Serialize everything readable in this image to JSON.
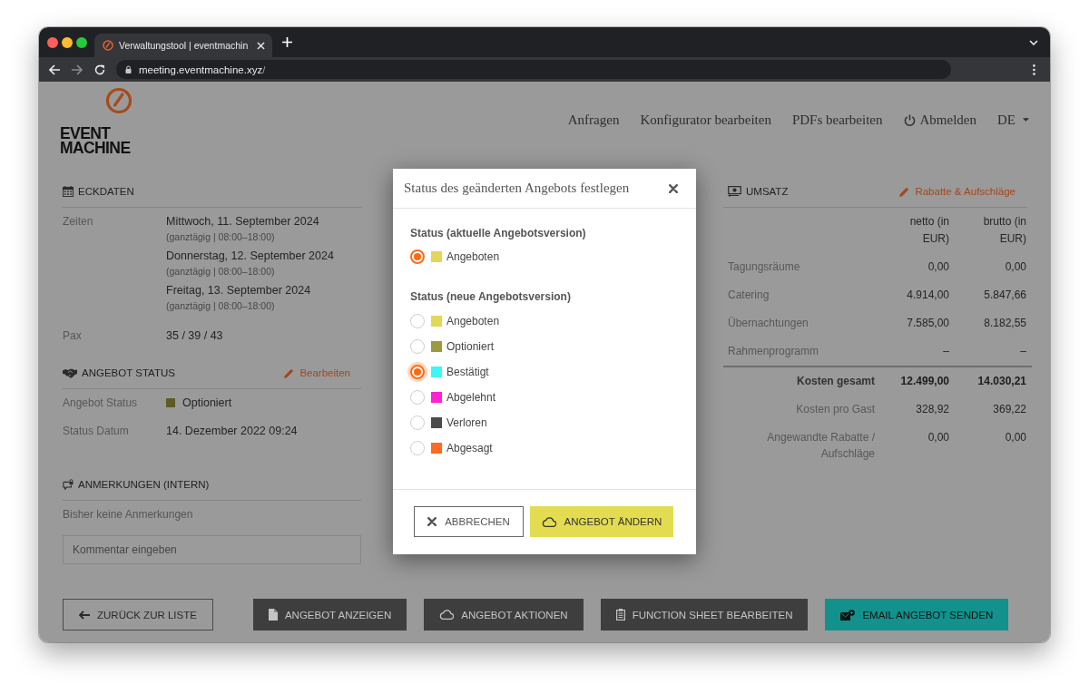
{
  "browser": {
    "tab_title": "Verwaltungstool | eventmachin",
    "url_host": "meeting.eventmachine.xyz",
    "url_path": "/"
  },
  "header": {
    "logo_text": "EVENT MACHINE",
    "nav": [
      {
        "kind": "link",
        "label": "Anfragen"
      },
      {
        "kind": "link",
        "label": "Konfigurator bearbeiten"
      },
      {
        "kind": "link",
        "label": "PDFs bearbeiten"
      },
      {
        "kind": "logout",
        "label": "Abmelden"
      },
      {
        "kind": "language",
        "label": "DE"
      }
    ]
  },
  "eckdaten": {
    "title": "ECKDATEN",
    "rows": [
      {
        "kind": "dates",
        "label": "Zeiten",
        "entries": [
          {
            "date": "Mittwoch, 11. September 2024",
            "note": "(ganztägig | 08:00–18:00)"
          },
          {
            "date": "Donnerstag, 12. September 2024",
            "note": "(ganztägig | 08:00–18:00)"
          },
          {
            "date": "Freitag, 13. September 2024",
            "note": "(ganztägig | 08:00–18:00)"
          }
        ]
      },
      {
        "kind": "text",
        "label": "Pax",
        "value": "35 / 39 / 43"
      }
    ]
  },
  "angebot_status": {
    "title": "ANGEBOT STATUS",
    "action": "Bearbeiten",
    "rows": [
      {
        "kind": "status",
        "label": "Angebot Status",
        "value": "Optioniert",
        "color": "#5c5c24"
      },
      {
        "kind": "text",
        "label": "Status Datum",
        "value": "14. Dezember 2022 09:24"
      }
    ]
  },
  "anmerkungen": {
    "title": "ANMERKUNGEN (INTERN)",
    "empty_text": "Bisher keine Anmerkungen",
    "comment_field": {
      "placeholder": "Kommentar eingeben"
    }
  },
  "umsatz": {
    "title": "UMSATZ",
    "action": "Rabatte & Aufschläge",
    "columns": [
      "netto (in EUR)",
      "brutto (in EUR)"
    ],
    "rows": [
      {
        "label": "Tagungsräume",
        "netto": "0,00",
        "brutto": "0,00"
      },
      {
        "label": "Catering",
        "netto": "4.914,00",
        "brutto": "5.847,66"
      },
      {
        "label": "Übernachtungen",
        "netto": "7.585,00",
        "brutto": "8.182,55"
      },
      {
        "label": "Rahmenprogramm",
        "netto": "–",
        "brutto": "–"
      }
    ],
    "summary": [
      {
        "kind": "total",
        "label": "Kosten gesamt",
        "netto": "12.499,00",
        "brutto": "14.030,21"
      },
      {
        "kind": "plain",
        "label": "Kosten pro Gast",
        "netto": "328,92",
        "brutto": "369,22"
      },
      {
        "kind": "plain",
        "label": "Angewandte Rabatte / Aufschläge",
        "netto": "0,00",
        "brutto": "0,00"
      }
    ]
  },
  "footer_buttons": [
    {
      "kind": "outline",
      "label": "ZURÜCK ZUR LISTE"
    },
    {
      "kind": "dark",
      "label": "ANGEBOT ANZEIGEN"
    },
    {
      "kind": "dark",
      "label": "ANGEBOT AKTIONEN"
    },
    {
      "kind": "dark",
      "label": "FUNCTION SHEET BEARBEITEN"
    },
    {
      "kind": "teal",
      "label": "EMAIL ANGEBOT SENDEN"
    }
  ],
  "modal": {
    "title": "Status des geänderten Angebots festlegen",
    "groups": [
      {
        "label": "Status (aktuelle Angebotsversion)",
        "options": [
          {
            "label": "Angeboten",
            "color": "#e2d756",
            "selected": true,
            "focused": false
          }
        ]
      },
      {
        "label": "Status (neue Angebotsversion)",
        "options": [
          {
            "label": "Angeboten",
            "color": "#e2d756",
            "selected": false,
            "focused": false
          },
          {
            "label": "Optioniert",
            "color": "#9b9a3c",
            "selected": false,
            "focused": false
          },
          {
            "label": "Bestätigt",
            "color": "#3ef6f4",
            "selected": true,
            "focused": true
          },
          {
            "label": "Abgelehnt",
            "color": "#fe22d2",
            "selected": false,
            "focused": false
          },
          {
            "label": "Verloren",
            "color": "#4b4b4b",
            "selected": false,
            "focused": false
          },
          {
            "label": "Abgesagt",
            "color": "#ff6a22",
            "selected": false,
            "focused": false
          }
        ]
      }
    ],
    "buttons": [
      {
        "kind": "cancel",
        "label": "ABBRECHEN"
      },
      {
        "kind": "confirm",
        "label": "ANGEBOT ÄNDERN"
      }
    ]
  }
}
